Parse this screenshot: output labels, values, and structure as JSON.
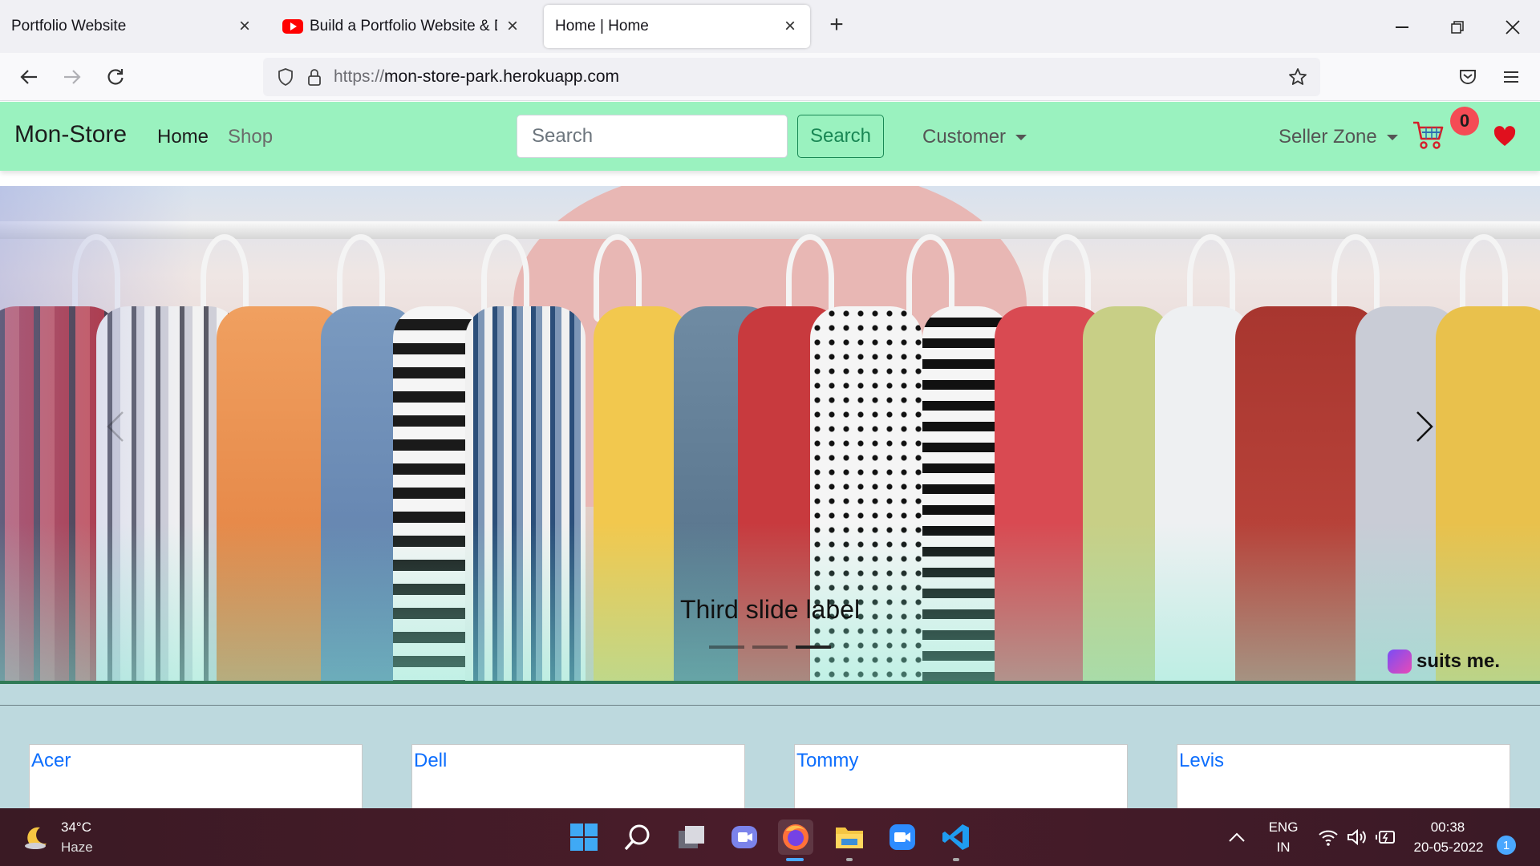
{
  "browser": {
    "tabs": [
      {
        "title": "Portfolio Website"
      },
      {
        "title": "Build a Portfolio Website & Dep"
      },
      {
        "title": "Home | Home"
      }
    ],
    "url_protocol": "https://",
    "url_host": "mon-store-park.herokuapp.com"
  },
  "site": {
    "brand": "Mon-Store",
    "nav": {
      "home": "Home",
      "shop": "Shop"
    },
    "search": {
      "placeholder": "Search",
      "button": "Search"
    },
    "customer_menu": "Customer",
    "seller_menu": "Seller Zone",
    "cart_count": "0"
  },
  "carousel": {
    "caption": "Third slide label",
    "slides": 3,
    "active_slide": 3,
    "watermark": "suits me."
  },
  "brands": [
    "Acer",
    "Dell",
    "Tommy",
    "Levis"
  ],
  "taskbar": {
    "temperature": "34°C",
    "condition": "Haze",
    "lang_top": "ENG",
    "lang_bottom": "IN",
    "time": "00:38",
    "date": "20-05-2022",
    "notifications": "1"
  },
  "colors": {
    "navbar_bg": "#9af2bf",
    "success": "#198754",
    "badge": "#f54b55",
    "link": "#0d6efd",
    "heart": "#e0101e"
  }
}
